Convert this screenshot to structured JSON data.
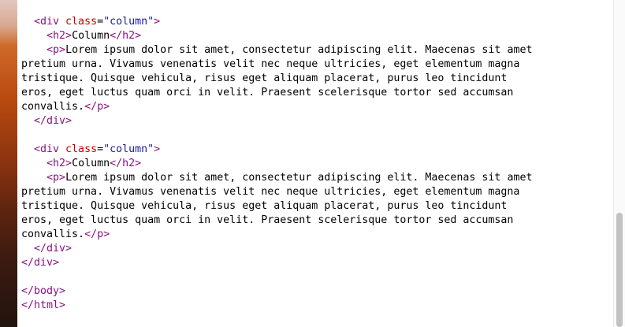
{
  "source_lines": [
    {
      "indent": "  ",
      "parts": [
        [
          "tag",
          "<div "
        ],
        [
          "attr",
          "class"
        ],
        [
          "plain",
          "="
        ],
        [
          "val",
          "\"column\""
        ],
        [
          "tag",
          ">"
        ]
      ]
    },
    {
      "indent": "    ",
      "parts": [
        [
          "tag",
          "<h2>"
        ],
        [
          "plain",
          "Column"
        ],
        [
          "tag",
          "</h2>"
        ]
      ]
    },
    {
      "indent": "    ",
      "parts": [
        [
          "tag",
          "<p>"
        ],
        [
          "plain",
          "Lorem ipsum dolor sit amet, consectetur adipiscing elit. Maecenas sit amet"
        ]
      ]
    },
    {
      "indent": "",
      "parts": [
        [
          "plain",
          "pretium urna. Vivamus venenatis velit nec neque ultricies, eget elementum magna"
        ]
      ]
    },
    {
      "indent": "",
      "parts": [
        [
          "plain",
          "tristique. Quisque vehicula, risus eget aliquam placerat, purus leo tincidunt"
        ]
      ]
    },
    {
      "indent": "",
      "parts": [
        [
          "plain",
          "eros, eget luctus quam orci in velit. Praesent scelerisque tortor sed accumsan"
        ]
      ]
    },
    {
      "indent": "",
      "parts": [
        [
          "plain",
          "convallis."
        ],
        [
          "tag",
          "</p>"
        ]
      ]
    },
    {
      "indent": "  ",
      "parts": [
        [
          "tag",
          "</div>"
        ]
      ]
    },
    {
      "indent": "",
      "parts": []
    },
    {
      "indent": "  ",
      "parts": [
        [
          "tag",
          "<div "
        ],
        [
          "attr",
          "class"
        ],
        [
          "plain",
          "="
        ],
        [
          "val",
          "\"column\""
        ],
        [
          "tag",
          ">"
        ]
      ]
    },
    {
      "indent": "    ",
      "parts": [
        [
          "tag",
          "<h2>"
        ],
        [
          "plain",
          "Column"
        ],
        [
          "tag",
          "</h2>"
        ]
      ]
    },
    {
      "indent": "    ",
      "parts": [
        [
          "tag",
          "<p>"
        ],
        [
          "plain",
          "Lorem ipsum dolor sit amet, consectetur adipiscing elit. Maecenas sit amet"
        ]
      ]
    },
    {
      "indent": "",
      "parts": [
        [
          "plain",
          "pretium urna. Vivamus venenatis velit nec neque ultricies, eget elementum magna"
        ]
      ]
    },
    {
      "indent": "",
      "parts": [
        [
          "plain",
          "tristique. Quisque vehicula, risus eget aliquam placerat, purus leo tincidunt"
        ]
      ]
    },
    {
      "indent": "",
      "parts": [
        [
          "plain",
          "eros, eget luctus quam orci in velit. Praesent scelerisque tortor sed accumsan"
        ]
      ]
    },
    {
      "indent": "",
      "parts": [
        [
          "plain",
          "convallis."
        ],
        [
          "tag",
          "</p>"
        ]
      ]
    },
    {
      "indent": "  ",
      "parts": [
        [
          "tag",
          "</div>"
        ]
      ]
    },
    {
      "indent": "",
      "parts": [
        [
          "tag",
          "</div>"
        ]
      ]
    },
    {
      "indent": "",
      "parts": []
    },
    {
      "indent": "",
      "parts": [
        [
          "tag",
          "</body>"
        ]
      ]
    },
    {
      "indent": "",
      "parts": [
        [
          "tag",
          "</html>"
        ]
      ]
    }
  ],
  "colors": {
    "tag": "#881280",
    "attribute": "#c80000",
    "attribute_value": "#1a1aa6",
    "text": "#000000",
    "background": "#ffffff"
  },
  "scrollbar": {
    "position": "bottom"
  }
}
